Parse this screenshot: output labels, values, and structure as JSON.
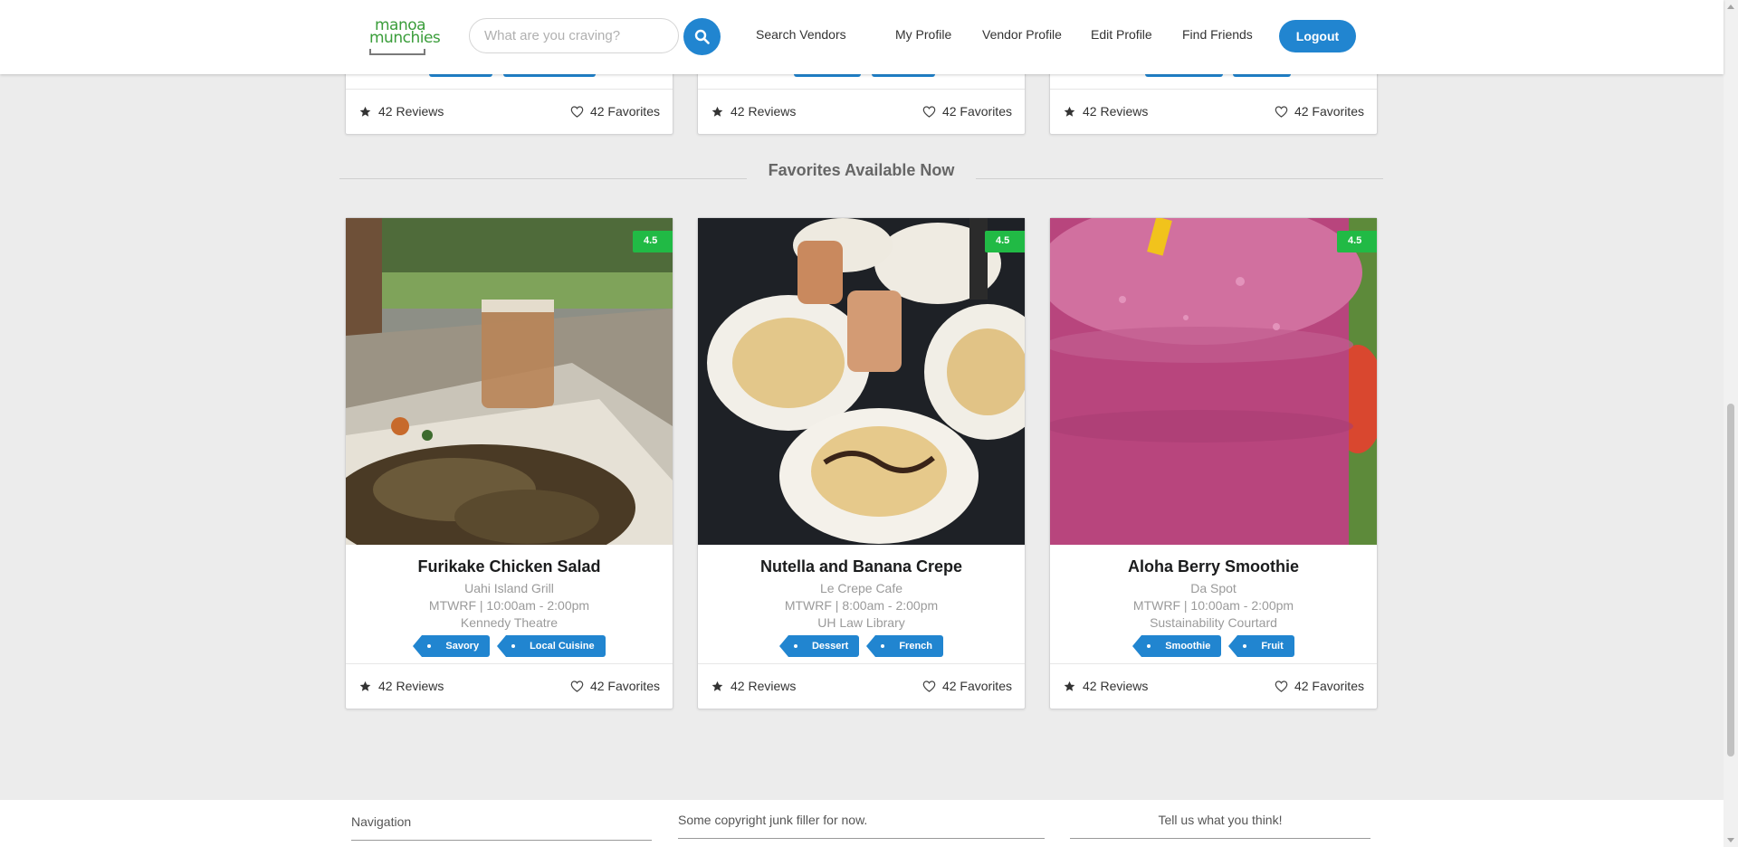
{
  "header": {
    "logo": {
      "line1": "manoa",
      "line2": "munchies"
    },
    "search_placeholder": "What are you craving?",
    "nav": [
      "Search Vendors",
      "My Profile",
      "Vendor Profile",
      "Edit Profile",
      "Find Friends"
    ],
    "logout_label": "Logout",
    "accent_color": "#2185d0"
  },
  "top_cards": [
    {
      "reviews": "42 Reviews",
      "favorites": "42 Favorites"
    },
    {
      "reviews": "42 Reviews",
      "favorites": "42 Favorites"
    },
    {
      "reviews": "42 Reviews",
      "favorites": "42 Favorites"
    }
  ],
  "section": {
    "title": "Favorites Available Now"
  },
  "cards": [
    {
      "rating": "4.5",
      "title": "Furikake Chicken Salad",
      "vendor": "Uahi Island Grill",
      "hours": "MTWRF | 10:00am - 2:00pm",
      "location": "Kennedy Theatre",
      "tags": [
        "Savory",
        "Local Cuisine"
      ],
      "reviews": "42 Reviews",
      "favorites": "42 Favorites"
    },
    {
      "rating": "4.5",
      "title": "Nutella and Banana Crepe",
      "vendor": "Le Crepe Cafe",
      "hours": "MTWRF | 8:00am - 2:00pm",
      "location": "UH Law Library",
      "tags": [
        "Dessert",
        "French"
      ],
      "reviews": "42 Reviews",
      "favorites": "42 Favorites"
    },
    {
      "rating": "4.5",
      "title": "Aloha Berry Smoothie",
      "vendor": "Da Spot",
      "hours": "MTWRF | 10:00am - 2:00pm",
      "location": "Sustainability Courtard",
      "tags": [
        "Smoothie",
        "Fruit"
      ],
      "reviews": "42 Reviews",
      "favorites": "42 Favorites"
    }
  ],
  "footer": {
    "navigation": "Navigation",
    "copyright": "Some copyright junk filler for now.",
    "feedback": "Tell us what you think!"
  },
  "colors": {
    "rating_badge": "#21ba45",
    "tag": "#2185d0",
    "logo_green": "#3a9d3a"
  }
}
